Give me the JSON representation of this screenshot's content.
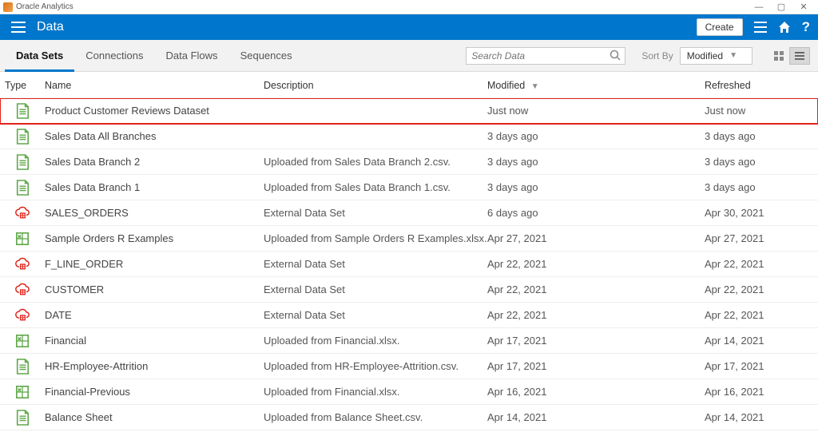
{
  "window": {
    "app_title": "Oracle Analytics",
    "min": "—",
    "max": "▢",
    "close": "✕"
  },
  "header": {
    "section": "Data",
    "create_label": "Create"
  },
  "toolbar": {
    "tabs": [
      {
        "label": "Data Sets",
        "active": true
      },
      {
        "label": "Connections"
      },
      {
        "label": "Data Flows"
      },
      {
        "label": "Sequences"
      }
    ],
    "search_placeholder": "Search Data",
    "sort_by_label": "Sort By",
    "sort_by_value": "Modified"
  },
  "columns": {
    "type": "Type",
    "name": "Name",
    "description": "Description",
    "modified": "Modified",
    "refreshed": "Refreshed"
  },
  "rows": [
    {
      "icon": "csv",
      "name": "Product Customer Reviews Dataset",
      "description": "",
      "modified": "Just now",
      "refreshed": "Just now",
      "highlighted": true
    },
    {
      "icon": "csv",
      "name": "Sales Data All Branches",
      "description": "",
      "modified": "3 days ago",
      "refreshed": "3 days ago"
    },
    {
      "icon": "csv",
      "name": "Sales Data Branch 2",
      "description": "Uploaded from Sales Data Branch 2.csv.",
      "modified": "3 days ago",
      "refreshed": "3 days ago"
    },
    {
      "icon": "csv",
      "name": "Sales Data Branch 1",
      "description": "Uploaded from Sales Data Branch 1.csv.",
      "modified": "3 days ago",
      "refreshed": "3 days ago"
    },
    {
      "icon": "ext",
      "name": "SALES_ORDERS",
      "description": "External Data Set",
      "modified": "6 days ago",
      "refreshed": "Apr 30, 2021"
    },
    {
      "icon": "xlsx",
      "name": "Sample Orders R Examples",
      "description": "Uploaded from Sample Orders R Examples.xlsx.",
      "modified": "Apr 27, 2021",
      "refreshed": "Apr 27, 2021"
    },
    {
      "icon": "ext",
      "name": "F_LINE_ORDER",
      "description": "External Data Set",
      "modified": "Apr 22, 2021",
      "refreshed": "Apr 22, 2021"
    },
    {
      "icon": "ext",
      "name": "CUSTOMER",
      "description": "External Data Set",
      "modified": "Apr 22, 2021",
      "refreshed": "Apr 22, 2021"
    },
    {
      "icon": "ext",
      "name": "DATE",
      "description": "External Data Set",
      "modified": "Apr 22, 2021",
      "refreshed": "Apr 22, 2021"
    },
    {
      "icon": "xlsx",
      "name": "Financial",
      "description": "Uploaded from Financial.xlsx.",
      "modified": "Apr 17, 2021",
      "refreshed": "Apr 14, 2021"
    },
    {
      "icon": "csv",
      "name": "HR-Employee-Attrition",
      "description": "Uploaded from HR-Employee-Attrition.csv.",
      "modified": "Apr 17, 2021",
      "refreshed": "Apr 17, 2021"
    },
    {
      "icon": "xlsx",
      "name": "Financial-Previous",
      "description": "Uploaded from Financial.xlsx.",
      "modified": "Apr 16, 2021",
      "refreshed": "Apr 16, 2021"
    },
    {
      "icon": "csv",
      "name": "Balance  Sheet",
      "description": "Uploaded from Balance  Sheet.csv.",
      "modified": "Apr 14, 2021",
      "refreshed": "Apr 14, 2021"
    }
  ]
}
